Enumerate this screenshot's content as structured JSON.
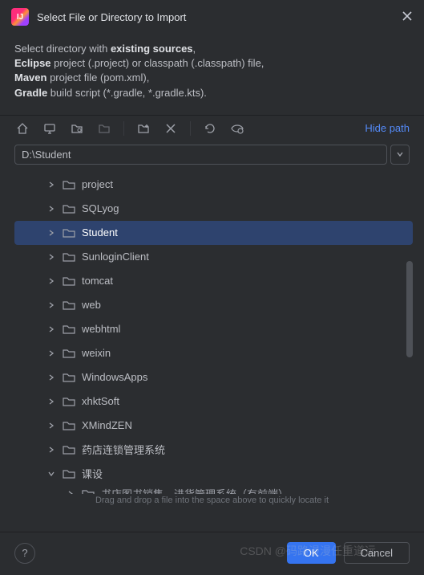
{
  "title": "Select File or Directory to Import",
  "description": {
    "line1_prefix": "Select directory with ",
    "line1_bold": "existing sources",
    "line1_suffix": ",",
    "line2_bold": "Eclipse",
    "line2_rest": " project (.project) or classpath (.classpath) file,",
    "line3_bold": "Maven",
    "line3_rest": " project file (pom.xml),",
    "line4_bold": "Gradle",
    "line4_rest": " build script (*.gradle, *.gradle.kts)."
  },
  "hide_path": "Hide path",
  "path_value": "D:\\Student",
  "tree": [
    {
      "label": "project",
      "expanded": false,
      "selected": false,
      "depth": 0
    },
    {
      "label": "SQLyog",
      "expanded": false,
      "selected": false,
      "depth": 0
    },
    {
      "label": "Student",
      "expanded": false,
      "selected": true,
      "depth": 0
    },
    {
      "label": "SunloginClient",
      "expanded": false,
      "selected": false,
      "depth": 0
    },
    {
      "label": "tomcat",
      "expanded": false,
      "selected": false,
      "depth": 0
    },
    {
      "label": "web",
      "expanded": false,
      "selected": false,
      "depth": 0
    },
    {
      "label": "webhtml",
      "expanded": false,
      "selected": false,
      "depth": 0
    },
    {
      "label": "weixin",
      "expanded": false,
      "selected": false,
      "depth": 0
    },
    {
      "label": "WindowsApps",
      "expanded": false,
      "selected": false,
      "depth": 0
    },
    {
      "label": "xhktSoft",
      "expanded": false,
      "selected": false,
      "depth": 0
    },
    {
      "label": "XMindZEN",
      "expanded": false,
      "selected": false,
      "depth": 0
    },
    {
      "label": "药店连锁管理系统",
      "expanded": false,
      "selected": false,
      "depth": 0
    },
    {
      "label": "课设",
      "expanded": true,
      "selected": false,
      "depth": 0
    }
  ],
  "tree_cut_label": "书店图书销售、进货管理系统（有前端）",
  "hint": "Drag and drop a file into the space above to quickly locate it",
  "buttons": {
    "ok": "OK",
    "cancel": "Cancel"
  },
  "watermark": "CSDN @码路漫漫任重道远"
}
